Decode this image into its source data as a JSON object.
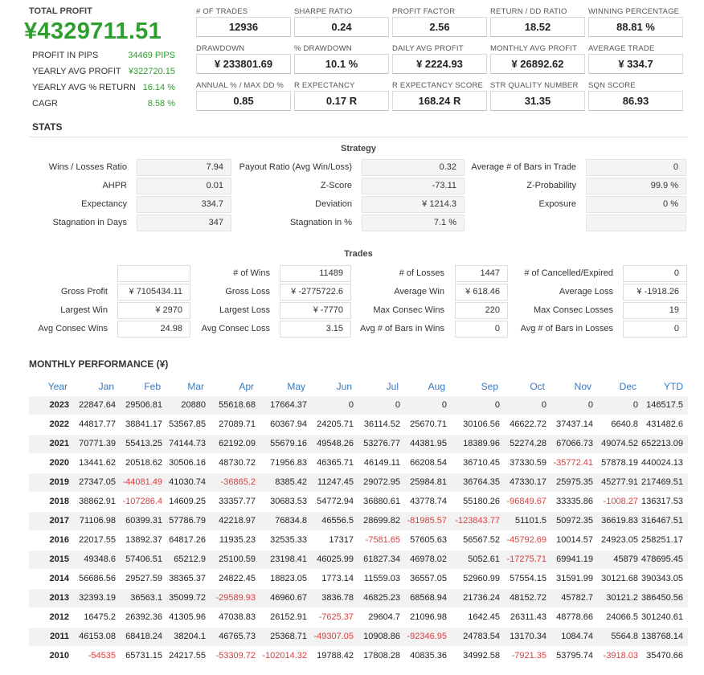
{
  "summary": {
    "total_profit_label": "TOTAL PROFIT",
    "total_profit_value": "¥4329711.51",
    "rows": [
      {
        "label": "PROFIT IN PIPS",
        "value": "34469 PIPS"
      },
      {
        "label": "YEARLY AVG PROFIT",
        "value": "¥322720.15"
      },
      {
        "label": "YEARLY AVG % RETURN",
        "value": "16.14 %"
      },
      {
        "label": "CAGR",
        "value": "8.58 %"
      }
    ]
  },
  "tiles": [
    {
      "label": "# OF TRADES",
      "value": "12936"
    },
    {
      "label": "SHARPE RATIO",
      "value": "0.24"
    },
    {
      "label": "PROFIT FACTOR",
      "value": "2.56"
    },
    {
      "label": "RETURN / DD RATIO",
      "value": "18.52"
    },
    {
      "label": "WINNING PERCENTAGE",
      "value": "88.81 %"
    },
    {
      "label": "DRAWDOWN",
      "value": "¥ 233801.69"
    },
    {
      "label": "% DRAWDOWN",
      "value": "10.1 %"
    },
    {
      "label": "DAILY AVG PROFIT",
      "value": "¥ 2224.93"
    },
    {
      "label": "MONTHLY AVG PROFIT",
      "value": "¥ 26892.62"
    },
    {
      "label": "AVERAGE TRADE",
      "value": "¥ 334.7"
    },
    {
      "label": "ANNUAL % / MAX DD %",
      "value": "0.85"
    },
    {
      "label": "R EXPECTANCY",
      "value": "0.17 R"
    },
    {
      "label": "R EXPECTANCY SCORE",
      "value": "168.24 R"
    },
    {
      "label": "STR QUALITY NUMBER",
      "value": "31.35"
    },
    {
      "label": "SQN SCORE",
      "value": "86.93"
    }
  ],
  "stats": {
    "title": "STATS",
    "strategy_title": "Strategy",
    "strategy": [
      [
        {
          "label": "Wins / Losses Ratio",
          "value": "7.94"
        },
        {
          "label": "Payout Ratio (Avg Win/Loss)",
          "value": "0.32"
        },
        {
          "label": "Average # of Bars in Trade",
          "value": "0"
        }
      ],
      [
        {
          "label": "AHPR",
          "value": "0.01"
        },
        {
          "label": "Z-Score",
          "value": "-73.11"
        },
        {
          "label": "Z-Probability",
          "value": "99.9 %"
        }
      ],
      [
        {
          "label": "Expectancy",
          "value": "334.7"
        },
        {
          "label": "Deviation",
          "value": "¥ 1214.3"
        },
        {
          "label": "Exposure",
          "value": "0 %"
        }
      ],
      [
        {
          "label": "Stagnation in Days",
          "value": "347"
        },
        {
          "label": "Stagnation in %",
          "value": "7.1 %"
        },
        {
          "label": "",
          "value": ""
        }
      ]
    ],
    "trades_title": "Trades",
    "trades": [
      [
        {
          "label": "",
          "value": ""
        },
        {
          "label": "# of Wins",
          "value": "11489"
        },
        {
          "label": "# of Losses",
          "value": "1447"
        },
        {
          "label": "# of Cancelled/Expired",
          "value": "0"
        }
      ],
      [
        {
          "label": "Gross Profit",
          "value": "¥ 7105434.11"
        },
        {
          "label": "Gross Loss",
          "value": "¥ -2775722.6"
        },
        {
          "label": "Average Win",
          "value": "¥ 618.46"
        },
        {
          "label": "Average Loss",
          "value": "¥ -1918.26"
        }
      ],
      [
        {
          "label": "Largest Win",
          "value": "¥ 2970"
        },
        {
          "label": "Largest Loss",
          "value": "¥ -7770"
        },
        {
          "label": "Max Consec Wins",
          "value": "220"
        },
        {
          "label": "Max Consec Losses",
          "value": "19"
        }
      ],
      [
        {
          "label": "Avg Consec Wins",
          "value": "24.98"
        },
        {
          "label": "Avg Consec Loss",
          "value": "3.15"
        },
        {
          "label": "Avg # of Bars in Wins",
          "value": "0"
        },
        {
          "label": "Avg # of Bars in Losses",
          "value": "0"
        }
      ]
    ]
  },
  "monthly": {
    "title": "MONTHLY PERFORMANCE (¥)",
    "headers": [
      "Year",
      "Jan",
      "Feb",
      "Mar",
      "Apr",
      "May",
      "Jun",
      "Jul",
      "Aug",
      "Sep",
      "Oct",
      "Nov",
      "Dec",
      "YTD"
    ],
    "rows": [
      [
        "2023",
        "22847.64",
        "29506.81",
        "20880",
        "55618.68",
        "17664.37",
        "0",
        "0",
        "0",
        "0",
        "0",
        "0",
        "0",
        "146517.5"
      ],
      [
        "2022",
        "44817.77",
        "38841.17",
        "53567.85",
        "27089.71",
        "60367.94",
        "24205.71",
        "36114.52",
        "25670.71",
        "30106.56",
        "46622.72",
        "37437.14",
        "6640.8",
        "431482.6"
      ],
      [
        "2021",
        "70771.39",
        "55413.25",
        "74144.73",
        "62192.09",
        "55679.16",
        "49548.26",
        "53276.77",
        "44381.95",
        "18389.96",
        "52274.28",
        "67066.73",
        "49074.52",
        "652213.09"
      ],
      [
        "2020",
        "13441.62",
        "20518.62",
        "30506.16",
        "48730.72",
        "71956.83",
        "46365.71",
        "46149.11",
        "66208.54",
        "36710.45",
        "37330.59",
        "-35772.41",
        "57878.19",
        "440024.13"
      ],
      [
        "2019",
        "27347.05",
        "-44081.49",
        "41030.74",
        "-36865.2",
        "8385.42",
        "11247.45",
        "29072.95",
        "25984.81",
        "36764.35",
        "47330.17",
        "25975.35",
        "45277.91",
        "217469.51"
      ],
      [
        "2018",
        "38862.91",
        "-107286.4",
        "14609.25",
        "33357.77",
        "30683.53",
        "54772.94",
        "36880.61",
        "43778.74",
        "55180.26",
        "-96849.67",
        "33335.86",
        "-1008.27",
        "136317.53"
      ],
      [
        "2017",
        "71106.98",
        "60399.31",
        "57786.79",
        "42218.97",
        "76834.8",
        "46556.5",
        "28699.82",
        "-81985.57",
        "-123843.77",
        "51101.5",
        "50972.35",
        "36619.83",
        "316467.51"
      ],
      [
        "2016",
        "22017.55",
        "13892.37",
        "64817.26",
        "11935.23",
        "32535.33",
        "17317",
        "-7581.65",
        "57605.63",
        "56567.52",
        "-45792.69",
        "10014.57",
        "24923.05",
        "258251.17"
      ],
      [
        "2015",
        "49348.6",
        "57406.51",
        "65212.9",
        "25100.59",
        "23198.41",
        "46025.99",
        "61827.34",
        "46978.02",
        "5052.61",
        "-17275.71",
        "69941.19",
        "45879",
        "478695.45"
      ],
      [
        "2014",
        "56686.56",
        "29527.59",
        "38365.37",
        "24822.45",
        "18823.05",
        "1773.14",
        "11559.03",
        "36557.05",
        "52960.99",
        "57554.15",
        "31591.99",
        "30121.68",
        "390343.05"
      ],
      [
        "2013",
        "32393.19",
        "36563.1",
        "35099.72",
        "-29589.93",
        "46960.67",
        "3836.78",
        "46825.23",
        "68568.94",
        "21736.24",
        "48152.72",
        "45782.7",
        "30121.2",
        "386450.56"
      ],
      [
        "2012",
        "16475.2",
        "26392.36",
        "41305.96",
        "47038.83",
        "26152.91",
        "-7625.37",
        "29604.7",
        "21096.98",
        "1642.45",
        "26311.43",
        "48778.66",
        "24066.5",
        "301240.61"
      ],
      [
        "2011",
        "46153.08",
        "68418.24",
        "38204.1",
        "46765.73",
        "25368.71",
        "-49307.05",
        "10908.86",
        "-92346.95",
        "24783.54",
        "13170.34",
        "1084.74",
        "5564.8",
        "138768.14"
      ],
      [
        "2010",
        "-54535",
        "65731.15",
        "24217.55",
        "-53309.72",
        "-102014.32",
        "19788.42",
        "17808.28",
        "40835.36",
        "34992.58",
        "-7921.35",
        "53795.74",
        "-3918.03",
        "35470.66"
      ]
    ]
  }
}
